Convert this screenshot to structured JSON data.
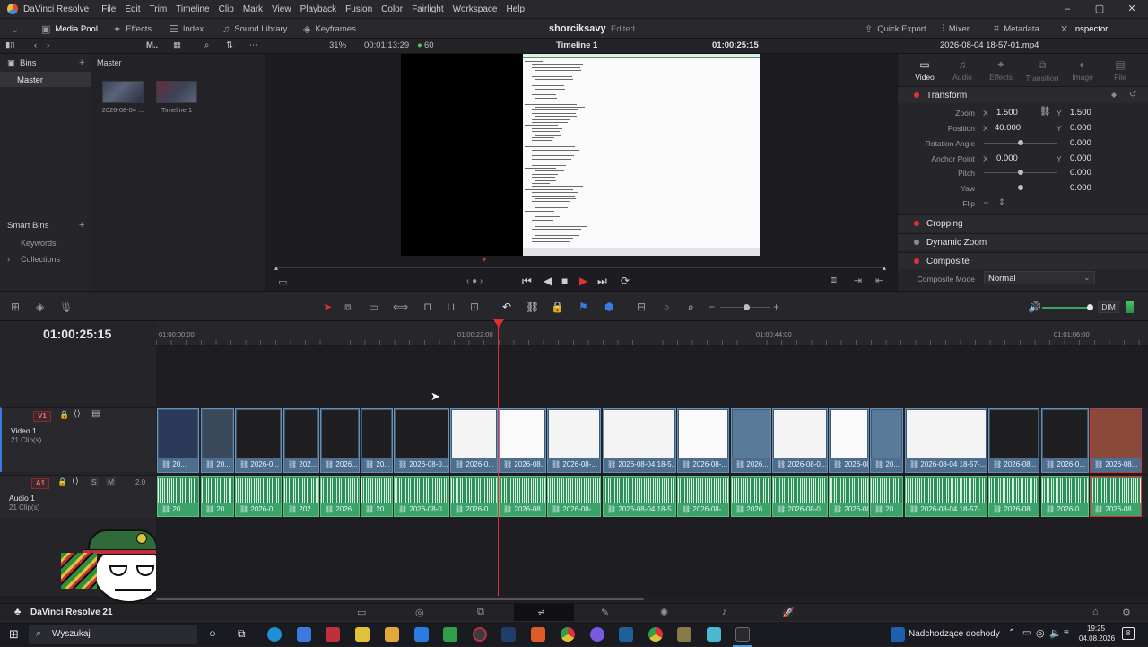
{
  "app": {
    "name": "DaVinci Resolve",
    "menus": [
      "File",
      "Edit",
      "Trim",
      "Timeline",
      "Clip",
      "Mark",
      "View",
      "Playback",
      "Fusion",
      "Color",
      "Fairlight",
      "Workspace",
      "Help"
    ]
  },
  "window_controls": [
    "–",
    "▢",
    "✕"
  ],
  "toolbar": {
    "media_pool": "Media Pool",
    "effects": "Effects",
    "index": "Index",
    "sound_library": "Sound Library",
    "keyframes": "Keyframes",
    "project_title": "shorciksavy",
    "edited": "Edited",
    "quick_export": "Quick Export",
    "mixer": "Mixer",
    "metadata": "Metadata",
    "inspector": "Inspector"
  },
  "viewer_bar": {
    "zoom": "31%",
    "timecode": "00:01:13:29",
    "fps": "60",
    "timeline_name": "Timeline 1",
    "current_tc": "01:00:25:15",
    "clip_name": "2026-08-04 18-57-01.mp4"
  },
  "bins": {
    "title": "Bins",
    "master": "Master",
    "smart_bins": "Smart Bins",
    "keywords": "Keywords",
    "collections": "Collections"
  },
  "media_pool": {
    "folder": "Master",
    "items": [
      {
        "label": "2026-08-04 ..."
      },
      {
        "label": "Timeline 1"
      }
    ]
  },
  "inspector": {
    "tabs": [
      {
        "label": "Video",
        "icon": "video-icon",
        "active": true
      },
      {
        "label": "Audio",
        "icon": "audio-icon",
        "active": false
      },
      {
        "label": "Effects",
        "icon": "effects-icon",
        "active": false
      },
      {
        "label": "Transition",
        "icon": "transition-icon",
        "active": false
      },
      {
        "label": "Image",
        "icon": "image-icon",
        "active": false
      },
      {
        "label": "File",
        "icon": "file-icon",
        "active": false
      }
    ],
    "transform": {
      "title": "Transform",
      "zoom_label": "Zoom",
      "zoom_x": "1.500",
      "zoom_y": "1.500",
      "position_label": "Position",
      "position_x": "40.000",
      "position_y": "0.000",
      "rotation_label": "Rotation Angle",
      "rotation": "0.000",
      "anchor_label": "Anchor Point",
      "anchor_x": "0.000",
      "anchor_y": "0.000",
      "pitch_label": "Pitch",
      "pitch": "0.000",
      "yaw_label": "Yaw",
      "yaw": "0.000",
      "flip_label": "Flip",
      "x_axis": "X",
      "y_axis": "Y"
    },
    "cropping": "Cropping",
    "dynamic_zoom": "Dynamic Zoom",
    "composite": "Composite",
    "composite_mode_label": "Composite Mode",
    "composite_mode": "Normal"
  },
  "timeline": {
    "timecode": "01:00:25:15",
    "ruler": [
      "01:00:00:00",
      "01:00:22:00",
      "01:00:44:00",
      "01:01:06:00"
    ],
    "video_track": {
      "id": "V1",
      "name": "Video 1",
      "count": "21 Clip(s)"
    },
    "audio_track": {
      "id": "A1",
      "name": "Audio 1",
      "count": "21 Clip(s)",
      "channels": "2.0"
    },
    "dim": "DIM",
    "clip_labels": [
      "20...",
      "20...",
      "2026-0...",
      "202...",
      "2026...",
      "20...",
      "2026-08-0...",
      "2026-0...",
      "2026-08...",
      "2026-08-...",
      "2026-08-04 18-5...",
      "2026-08-...",
      "2026...",
      "2026-08-0...",
      "2026-08...",
      "20...",
      "2026-08-04 18-57-...",
      "2026-08...",
      "2026-0...",
      "2026-08..."
    ]
  },
  "bottom": {
    "brand": "DaVinci Resolve 21"
  },
  "taskbar": {
    "search": "Wyszukaj",
    "news": "Nadchodzące dochody",
    "time": "19:25",
    "date": "04.08.2026",
    "notif": "8"
  },
  "colors": {
    "accent": "#e0303a",
    "video_clip": "#4d6f8f",
    "audio_clip": "#3aa368"
  }
}
